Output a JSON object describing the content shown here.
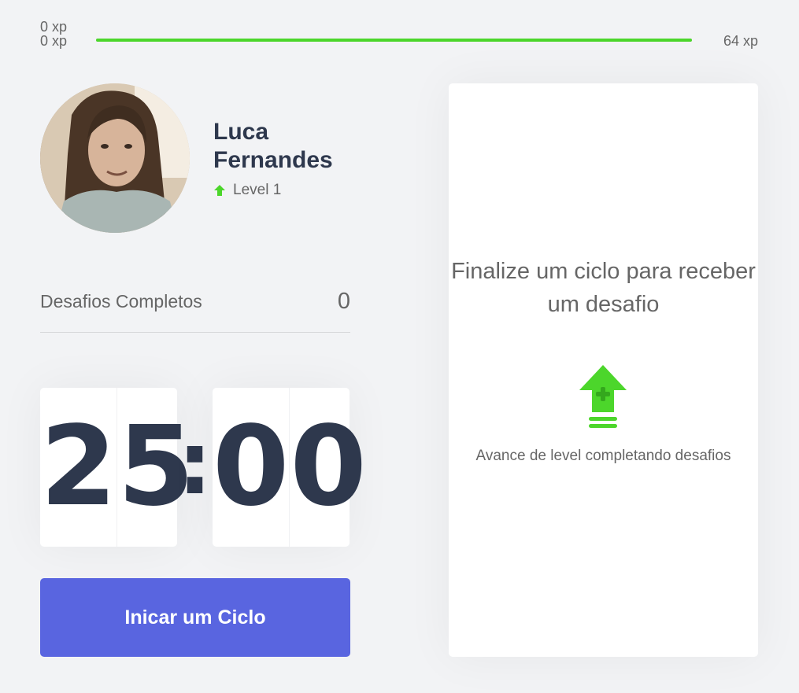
{
  "xp": {
    "min_label": "0 xp",
    "max_label": "64 xp",
    "current_label": "0 xp",
    "progress_fraction": 0
  },
  "profile": {
    "name": "Luca Fernandes",
    "level_label": "Level 1",
    "level_icon": "level-up-arrow-icon",
    "avatar": "user-avatar-photo"
  },
  "completed": {
    "label": "Desafios Completos",
    "count": "0"
  },
  "countdown": {
    "minute_left": "2",
    "minute_right": "5",
    "separator": ":",
    "second_left": "0",
    "second_right": "0"
  },
  "cycle_button": {
    "label": "Inicar um Ciclo"
  },
  "challenge": {
    "title": "Finalize um ciclo para receber um desafio",
    "hint": "Avance de level completando desafios",
    "icon": "level-up-icon"
  },
  "colors": {
    "background": "#f2f3f5",
    "accent_green": "#4cd62b",
    "button_blue": "#5965e0",
    "title_dark": "#2e384d",
    "text": "#666666"
  }
}
